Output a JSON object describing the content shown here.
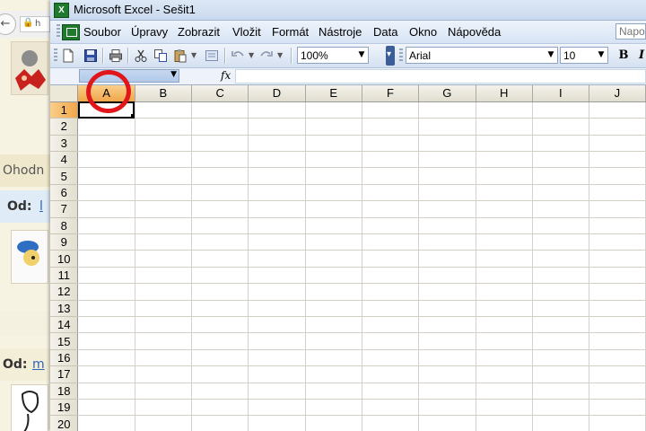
{
  "background_page": {
    "address_fragment": "h",
    "section_label": "Ohodn",
    "posts": [
      {
        "prefix": "Od:",
        "author_fragment": "l"
      },
      {
        "prefix": "Od:",
        "author_fragment": "m"
      }
    ]
  },
  "app": {
    "icon_letter": "X",
    "title": "Microsoft Excel - Sešit1"
  },
  "menu": {
    "items": [
      "Soubor",
      "Úpravy",
      "Zobrazit",
      "Vložit",
      "Formát",
      "Nástroje",
      "Data",
      "Okno",
      "Nápověda"
    ],
    "help_placeholder": "Napo"
  },
  "toolbar": {
    "zoom": "100%",
    "font_name": "Arial",
    "font_size": "10",
    "bold_label": "B",
    "italic_label": "I"
  },
  "formula_bar": {
    "name_box": "",
    "fx_label": "fx",
    "value": ""
  },
  "sheet": {
    "columns": [
      "A",
      "B",
      "C",
      "D",
      "E",
      "F",
      "G",
      "H",
      "I",
      "J"
    ],
    "rows": [
      "1",
      "2",
      "3",
      "4",
      "5",
      "6",
      "7",
      "8",
      "9",
      "10",
      "11",
      "12",
      "13",
      "14",
      "15",
      "16",
      "17",
      "18",
      "19",
      "20"
    ],
    "active_cell": "A1"
  },
  "colors": {
    "selected_header": "#f1a64a",
    "annotation_ring": "#e0161a",
    "excel_green": "#1f7a2e"
  }
}
